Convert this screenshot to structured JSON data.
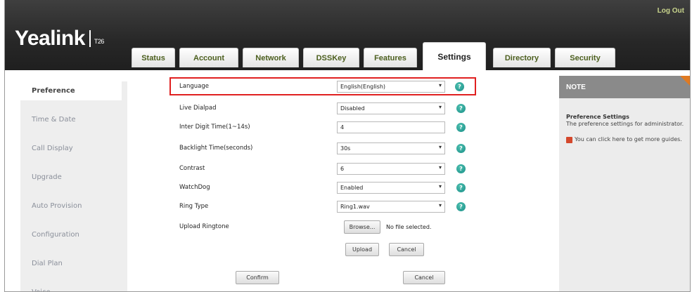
{
  "header": {
    "brand": "Yealink",
    "model": "T26",
    "logout_label": "Log Out"
  },
  "tabs": [
    {
      "label": "Status"
    },
    {
      "label": "Account"
    },
    {
      "label": "Network"
    },
    {
      "label": "DSSKey"
    },
    {
      "label": "Features"
    },
    {
      "label": "Settings"
    },
    {
      "label": "Directory"
    },
    {
      "label": "Security"
    }
  ],
  "active_tab": "Settings",
  "sidebar": {
    "items": [
      {
        "label": "Preference"
      },
      {
        "label": "Time & Date"
      },
      {
        "label": "Call Display"
      },
      {
        "label": "Upgrade"
      },
      {
        "label": "Auto Provision"
      },
      {
        "label": "Configuration"
      },
      {
        "label": "Dial Plan"
      },
      {
        "label": "Voice"
      }
    ],
    "active": "Preference"
  },
  "form": {
    "rows": [
      {
        "label": "Language",
        "value": "English(English)",
        "type": "select"
      },
      {
        "label": "Live Dialpad",
        "value": "Disabled",
        "type": "select"
      },
      {
        "label": "Inter Digit Time(1~14s)",
        "value": "4",
        "type": "text"
      },
      {
        "label": "Backlight Time(seconds)",
        "value": "30s",
        "type": "select"
      },
      {
        "label": "Contrast",
        "value": "6",
        "type": "select"
      },
      {
        "label": "WatchDog",
        "value": "Enabled",
        "type": "select"
      },
      {
        "label": "Ring Type",
        "value": "Ring1.wav",
        "type": "select"
      }
    ],
    "upload": {
      "label": "Upload Ringtone",
      "browse_label": "Browse...",
      "file_status": "No file selected.",
      "upload_label": "Upload",
      "cancel_label": "Cancel"
    },
    "confirm_label": "Confirm",
    "cancel_label": "Cancel",
    "help_glyph": "?",
    "select_arrow": "▾"
  },
  "note": {
    "header": "NOTE",
    "title": "Preference Settings",
    "text": "The preference settings for administrator.",
    "tip": "You can click here to get more guides."
  },
  "colors": {
    "header_bg": "#2b2b2b",
    "tab_text": "#4c5f1e",
    "highlight_border": "#e02020",
    "help_icon": "#1a8f88",
    "note_header": "#8a8a8a",
    "note_corner": "#e07a22"
  }
}
